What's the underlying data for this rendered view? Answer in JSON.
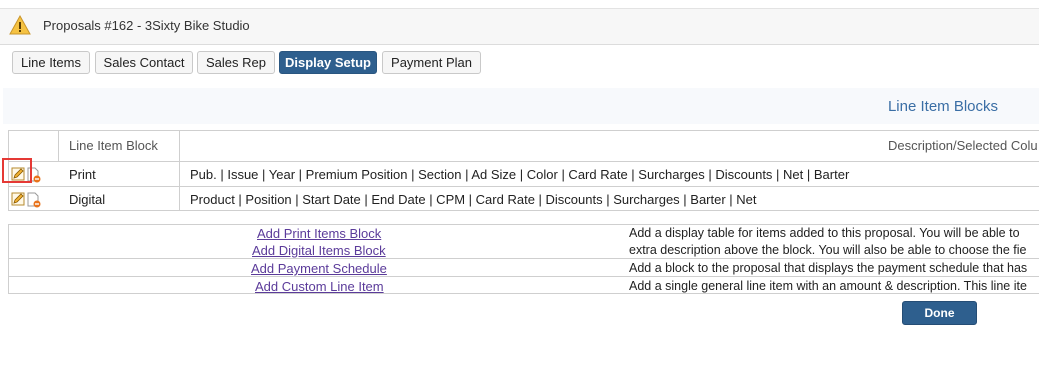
{
  "header": {
    "title": "Proposals #162 - 3Sixty Bike Studio",
    "icon": "warning-icon"
  },
  "tabs": [
    {
      "label": "Line Items",
      "active": false
    },
    {
      "label": "Sales Contact",
      "active": false
    },
    {
      "label": "Sales Rep",
      "active": false
    },
    {
      "label": "Display Setup",
      "active": true
    },
    {
      "label": "Payment Plan",
      "active": false
    }
  ],
  "section": {
    "title": "Line Item Blocks"
  },
  "blocks_table": {
    "columns": [
      "Line Item Block",
      "Description/Selected Colu"
    ],
    "rows": [
      {
        "block": "Print",
        "columns": "Pub. | Issue | Year | Premium Position | Section | Ad Size | Color | Card Rate | Surcharges | Discounts | Net | Barter"
      },
      {
        "block": "Digital",
        "columns": "Product | Position | Start Date | End Date | CPM | Card Rate | Discounts | Surcharges | Barter | Net"
      }
    ]
  },
  "options": [
    {
      "link": "Add Print Items Block",
      "desc": "Add a display table for items added to this proposal. You will be able to"
    },
    {
      "link": "Add Digital Items Block",
      "desc": "extra description above the block. You will also be able to choose the fie"
    },
    {
      "link": "Add Payment Schedule",
      "desc": "Add a block to the proposal that displays the payment schedule that has"
    },
    {
      "link": "Add Custom Line Item",
      "desc": "Add a single general line item with an amount & description. This line ite"
    }
  ],
  "done_label": "Done",
  "colors": {
    "accent": "#2e5f8e",
    "link": "#5b3b9a",
    "highlight": "#e53935",
    "section_title": "#3a6ea5"
  }
}
